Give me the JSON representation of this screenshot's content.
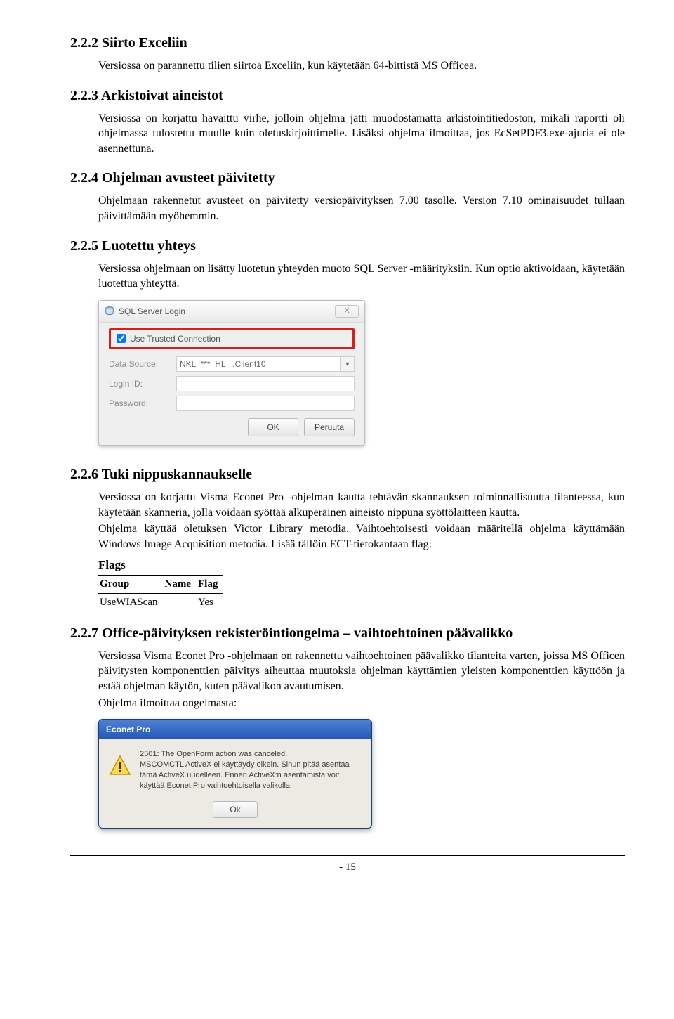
{
  "sections": {
    "s222": {
      "title": "2.2.2 Siirto Exceliin",
      "p1": "Versiossa on parannettu tilien siirtoa Exceliin, kun käytetään 64-bittistä MS Officea."
    },
    "s223": {
      "title": "2.2.3 Arkistoivat aineistot",
      "p1": "Versiossa on korjattu havaittu virhe, jolloin ohjelma jätti muodostamatta arkistointitiedoston, mikäli raportti oli ohjelmassa tulostettu muulle kuin oletuskirjoittimelle. Lisäksi ohjelma ilmoittaa, jos EcSetPDF3.exe-ajuria ei ole asennettuna."
    },
    "s224": {
      "title": "2.2.4 Ohjelman avusteet päivitetty",
      "p1": "Ohjelmaan rakennetut avusteet on päivitetty versiopäivityksen 7.00 tasolle. Version 7.10 ominaisuudet tullaan päivittämään myöhemmin."
    },
    "s225": {
      "title": "2.2.5 Luotettu yhteys",
      "p1": "Versiossa ohjelmaan on lisätty luotetun yhteyden muoto SQL Server -määrityksiin. Kun optio aktivoidaan, käytetään luotettua yhteyttä."
    },
    "s226": {
      "title": "2.2.6 Tuki nippuskannaukselle",
      "p1": "Versiossa on korjattu Visma Econet Pro -ohjelman kautta tehtävän skannauksen toiminnallisuutta tilanteessa, kun käytetään skanneria, jolla voidaan syöttää alkuperäinen aineisto nippuna syöttölaitteen kautta.",
      "p2": "Ohjelma käyttää oletuksen Victor Library metodia. Vaihtoehtoisesti voidaan määritellä ohjelma käyttämään Windows Image Acquisition metodia. Lisää tällöin ECT-tietokantaan flag:"
    },
    "s227": {
      "title": "2.2.7 Office-päivityksen rekisteröintiongelma – vaihtoehtoinen päävalikko",
      "p1": "Versiossa Visma Econet Pro -ohjelmaan on rakennettu vaihtoehtoinen päävalikko tilanteita varten, joissa MS Officen päivitysten komponenttien päivitys aiheuttaa muutoksia ohjelman käyttämien yleisten komponenttien käyttöön ja estää ohjelman käytön, kuten päävalikon avautumisen.",
      "p2": "Ohjelma ilmoittaa ongelmasta:"
    }
  },
  "sql_dialog": {
    "title": "SQL Server Login",
    "close_x": "X",
    "trusted_label": "Use Trusted Connection",
    "data_source_label": "Data Source:",
    "data_source_value": "NKL  ***  HL   .Client10",
    "login_label": "Login ID:",
    "password_label": "Password:",
    "ok": "OK",
    "cancel": "Peruuta"
  },
  "flags_table": {
    "caption": "Flags",
    "headers": [
      "Group_",
      "Name",
      "Flag"
    ],
    "row": [
      "UseWIAScan",
      "",
      "Yes"
    ]
  },
  "econet_dialog": {
    "title": "Econet Pro",
    "msg": "2501: The OpenForm action was canceled.\nMSCOMCTL ActiveX ei käyttäydy oikein. Sinun pitää asentaa tämä ActiveX uudelleen. Ennen ActiveX:n asentamista voit käyttää Econet Pro vaihtoehtoisella valikolla.",
    "ok": "Ok"
  },
  "footer": "- 15"
}
